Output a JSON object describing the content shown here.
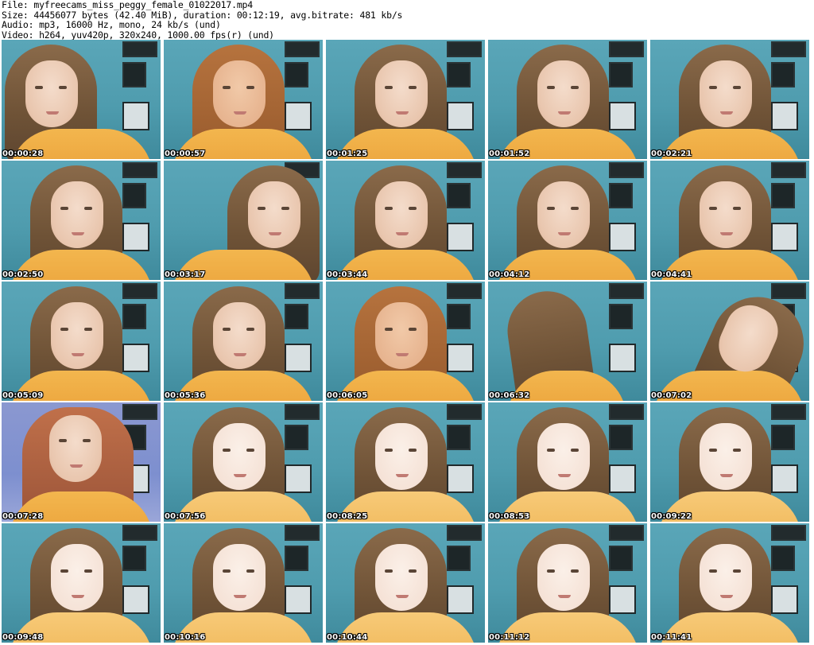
{
  "header": {
    "file_line": "File: myfreecams_miss_peggy_female_01022017.mp4",
    "size_line": "Size: 44456077 bytes (42.40 MiB), duration: 00:12:19, avg.bitrate: 481 kb/s",
    "audio_line": "Audio: mp3, 16000 Hz, mono, 24 kb/s (und)",
    "video_line": "Video: h264, yuv420p, 320x240, 1000.00 fps(r) (und)"
  },
  "thumbnails": [
    {
      "timestamp": "00:00:28",
      "variant": "v-left"
    },
    {
      "timestamp": "00:00:57",
      "variant": "v-warm"
    },
    {
      "timestamp": "00:01:25",
      "variant": ""
    },
    {
      "timestamp": "00:01:52",
      "variant": ""
    },
    {
      "timestamp": "00:02:21",
      "variant": ""
    },
    {
      "timestamp": "00:02:50",
      "variant": ""
    },
    {
      "timestamp": "00:03:17",
      "variant": "v-right"
    },
    {
      "timestamp": "00:03:44",
      "variant": ""
    },
    {
      "timestamp": "00:04:12",
      "variant": ""
    },
    {
      "timestamp": "00:04:41",
      "variant": ""
    },
    {
      "timestamp": "00:05:09",
      "variant": ""
    },
    {
      "timestamp": "00:05:36",
      "variant": ""
    },
    {
      "timestamp": "00:06:05",
      "variant": "v-warm"
    },
    {
      "timestamp": "00:06:32",
      "variant": "v-far"
    },
    {
      "timestamp": "00:07:02",
      "variant": "v-tilt"
    },
    {
      "timestamp": "00:07:28",
      "variant": "v-pale"
    },
    {
      "timestamp": "00:07:56",
      "variant": "v-bright"
    },
    {
      "timestamp": "00:08:25",
      "variant": "v-bright"
    },
    {
      "timestamp": "00:08:53",
      "variant": "v-bright"
    },
    {
      "timestamp": "00:09:22",
      "variant": "v-bright"
    },
    {
      "timestamp": "00:09:48",
      "variant": "v-bright"
    },
    {
      "timestamp": "00:10:16",
      "variant": "v-bright"
    },
    {
      "timestamp": "00:10:44",
      "variant": "v-bright"
    },
    {
      "timestamp": "00:11:12",
      "variant": "v-bright"
    },
    {
      "timestamp": "00:11:41",
      "variant": "v-bright"
    }
  ]
}
